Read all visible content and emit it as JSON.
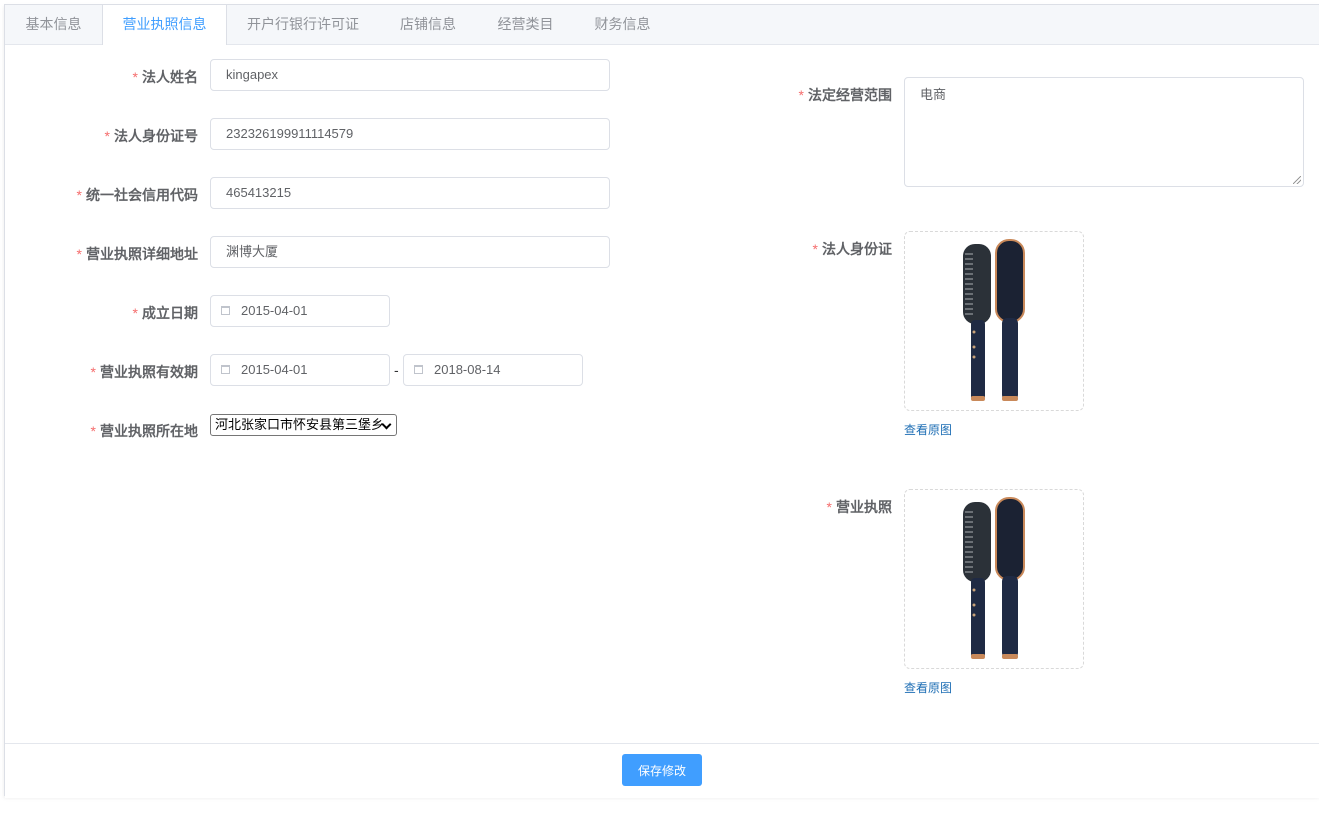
{
  "tabs": [
    {
      "label": "基本信息"
    },
    {
      "label": "营业执照信息"
    },
    {
      "label": "开户行银行许可证"
    },
    {
      "label": "店铺信息"
    },
    {
      "label": "经营类目"
    },
    {
      "label": "财务信息"
    }
  ],
  "active_tab": "营业执照信息",
  "required_mark": "*",
  "form": {
    "legal_name": {
      "label": "法人姓名",
      "value": "kingapex"
    },
    "legal_id": {
      "label": "法人身份证号",
      "value": "232326199911114579"
    },
    "credit_code": {
      "label": "统一社会信用代码",
      "value": "465413215"
    },
    "address": {
      "label": "营业执照详细地址",
      "value": "渊博大厦"
    },
    "establish_date": {
      "label": "成立日期",
      "value": "2015-04-01"
    },
    "valid_period": {
      "label": "营业执照有效期",
      "start": "2015-04-01",
      "separator": "-",
      "end": "2018-08-14"
    },
    "location": {
      "label": "营业执照所在地",
      "value": "河北张家口市怀安县第三堡乡"
    },
    "scope": {
      "label": "法定经营范围",
      "value": "电商"
    },
    "id_card": {
      "label": "法人身份证",
      "link": "查看原图"
    },
    "license": {
      "label": "营业执照",
      "link": "查看原图"
    }
  },
  "footer": {
    "save_label": "保存修改"
  },
  "colors": {
    "primary": "#409eff",
    "required": "#f56c6c",
    "link": "#1f6fb5"
  },
  "icons": {
    "calendar": "calendar-icon",
    "dropdown": "chevron-down-icon",
    "product": "hair-straightener-brush-image"
  }
}
